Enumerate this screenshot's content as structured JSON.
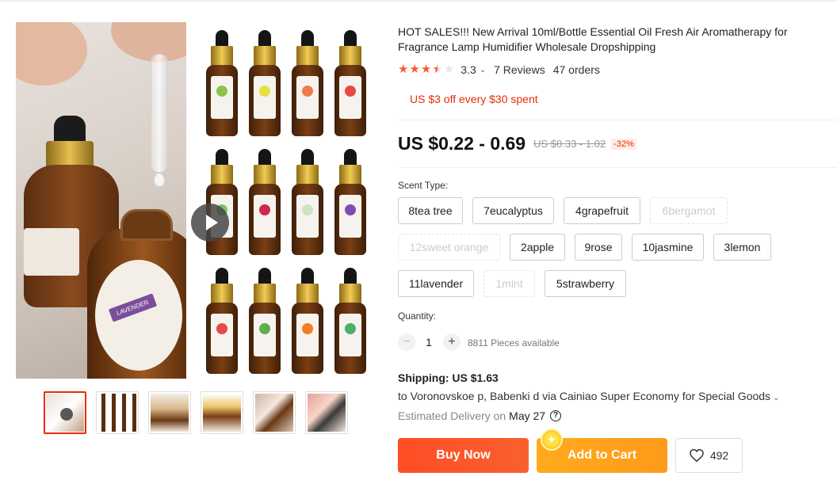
{
  "product": {
    "title": "HOT SALES!!! New Arrival 10ml/Bottle Essential Oil Fresh Air Aromatherapy for Fragrance Lamp Humidifier Wholesale Dropshipping",
    "rating": "3.3",
    "reviews": "7 Reviews",
    "orders": "47 orders",
    "stars": {
      "full": 3,
      "half": 1,
      "empty": 1
    }
  },
  "coupon": "US $3 off every $30 spent",
  "pricing": {
    "price": "US $0.22 - 0.69",
    "original": "US $0.33 - 1.02",
    "discount": "-32%"
  },
  "sku": {
    "label": "Scent Type:",
    "options": [
      {
        "label": "8tea tree",
        "available": true
      },
      {
        "label": "7eucalyptus",
        "available": true
      },
      {
        "label": "4grapefruit",
        "available": true
      },
      {
        "label": "6bergamot",
        "available": false
      },
      {
        "label": "12sweet orange",
        "available": false
      },
      {
        "label": "2apple",
        "available": true
      },
      {
        "label": "9rose",
        "available": true
      },
      {
        "label": "10jasmine",
        "available": true
      },
      {
        "label": "3lemon",
        "available": true
      },
      {
        "label": "11lavender",
        "available": true
      },
      {
        "label": "1mint",
        "available": false
      },
      {
        "label": "5strawberry",
        "available": true
      }
    ]
  },
  "quantity": {
    "label": "Quantity:",
    "value": "1",
    "minus": "−",
    "plus": "+",
    "stock": "8811 Pieces available"
  },
  "shipping": {
    "title": "Shipping: US $1.63",
    "to": "to Voronovskoe p, Babenki d via Cainiao Super Economy for Special Goods",
    "estimated_label": "Estimated Delivery on",
    "estimated_date": "May 27",
    "help": "?"
  },
  "actions": {
    "buy_now": "Buy Now",
    "add_to_cart": "Add to Cart",
    "wishlist_count": "492"
  },
  "gallery": {
    "lavender_label": "LAVENDER",
    "thumbnails": 6
  },
  "colors": {
    "accent": "#e62e04",
    "buy_now": "#ff4d26",
    "add_to_cart": "#ffab1d",
    "star": "#f55a36"
  },
  "icons": [
    "play-icon",
    "star-icon",
    "chevron-down-icon",
    "help-icon",
    "heart-icon",
    "coin-icon"
  ]
}
